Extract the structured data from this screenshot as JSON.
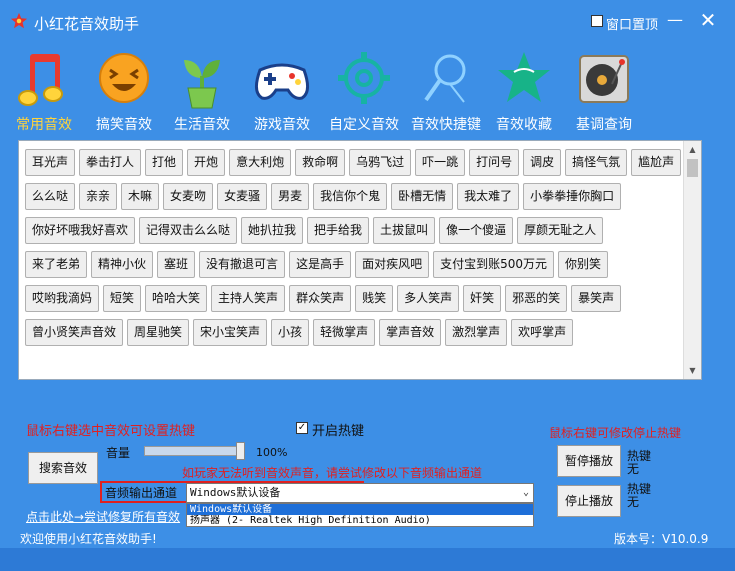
{
  "window": {
    "title": "小红花音效助手",
    "pin_label": "窗口置顶",
    "minimize": "—",
    "close": "✕"
  },
  "nav": {
    "items": [
      {
        "label": "常用音效",
        "icon": "music-note-icon",
        "active": true
      },
      {
        "label": "搞笑音效",
        "icon": "laughing-face-icon"
      },
      {
        "label": "生活音效",
        "icon": "plant-sprout-icon"
      },
      {
        "label": "游戏音效",
        "icon": "gamepad-icon"
      },
      {
        "label": "自定义音效",
        "icon": "gear-icon"
      },
      {
        "label": "音效快捷键",
        "icon": "magnifier-icon"
      },
      {
        "label": "音效收藏",
        "icon": "star-icon"
      },
      {
        "label": "基调查询",
        "icon": "record-player-icon"
      }
    ],
    "colors": {
      "active": "#ffd43b",
      "normal": "#ffffff"
    }
  },
  "sounds": {
    "rows": [
      [
        "耳光声",
        "拳击打人",
        "打他",
        "开炮",
        "意大利炮",
        "救命啊",
        "乌鸦飞过",
        "吓一跳",
        "打问号",
        "调皮",
        "搞怪气氛",
        "尴尬声"
      ],
      [
        "么么哒",
        "亲亲",
        "木嘛",
        "女麦吻",
        "女麦骚",
        "男麦",
        "我信你个鬼",
        "卧槽无情",
        "我太难了",
        "小拳拳捶你胸口"
      ],
      [
        "你好坏哦我好喜欢",
        "记得双击么么哒",
        "她扒拉我",
        "把手给我",
        "土拔鼠叫",
        "像一个傻逼",
        "厚颜无耻之人"
      ],
      [
        "来了老弟",
        "精神小伙",
        "塞班",
        "没有撤退可言",
        "这是高手",
        "面对疾风吧",
        "支付宝到账500万元",
        "你别笑"
      ],
      [
        "哎哟我滴妈",
        "短笑",
        "哈哈大笑",
        "主持人笑声",
        "群众笑声",
        "贱笑",
        "多人笑声",
        "奸笑",
        "邪恶的笑",
        "暴笑声"
      ],
      [
        "曾小贤笑声音效",
        "周星驰笑",
        "宋小宝笑声",
        "小孩",
        "轻微掌声",
        "掌声音效",
        "激烈掌声",
        "欢呼掌声"
      ]
    ]
  },
  "controls": {
    "hint_right_click": "鼠标右键选中音效可设置热键",
    "hotkey_check": "✓",
    "hotkey_label": "开启热键",
    "hint_stop": "鼠标右键可修改停止热键",
    "search_button": "搜索音效",
    "volume_label": "音量",
    "volume_value": "100%",
    "volume_fraction": 0.96,
    "warning": "如玩家无法听到音效声音，请尝试修改以下音频输出通道",
    "channel_label": "音频输出通道",
    "channel_selected": "Windows默认设备",
    "channel_caret": "⌄",
    "channel_options": [
      "Windows默认设备",
      "扬声器 (2- Realtek High Definition Audio)"
    ],
    "restore_link": "点击此处→尝试修复所有音效",
    "pause_button": "暂停播放",
    "stop_button": "停止播放",
    "pause_hotkey": "热键\n无",
    "stop_hotkey": "热键\n无"
  },
  "status": {
    "welcome": "欢迎使用小红花音效助手!",
    "version": "版本号：V10.0.9"
  }
}
